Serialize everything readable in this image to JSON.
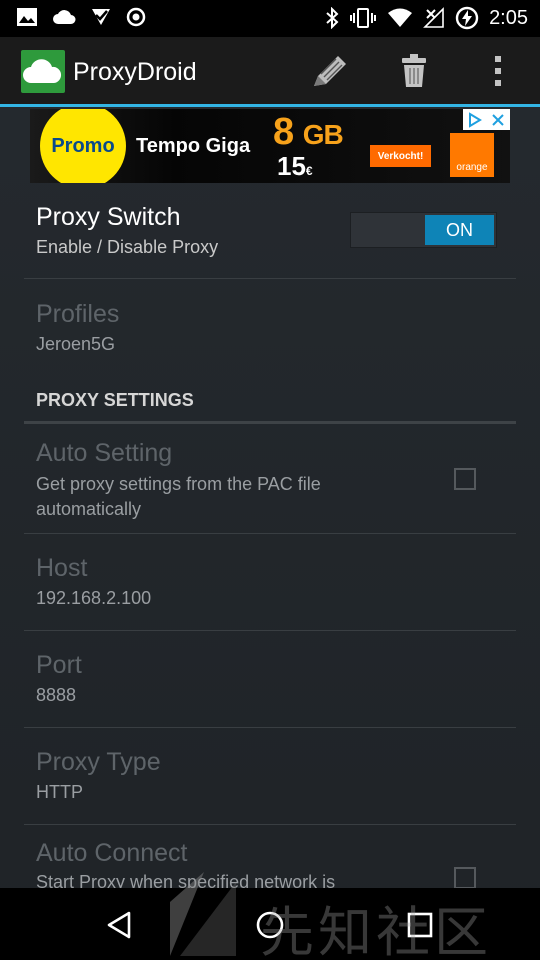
{
  "status_bar": {
    "time": "2:05",
    "icons": [
      "image-icon",
      "cloud-icon",
      "check-icon",
      "target-icon",
      "bluetooth-icon",
      "vibrate-icon",
      "wifi-icon",
      "no-signal-icon",
      "battery-charging-icon"
    ]
  },
  "action_bar": {
    "title": "ProxyDroid",
    "actions": [
      "edit-icon",
      "trash-icon",
      "overflow-menu-icon"
    ],
    "accent_color": "#33b5e5"
  },
  "ad": {
    "promo": "Promo",
    "headline": "Tempo Giga",
    "amount": "8",
    "unit": "GB",
    "price": "15",
    "currency": "€",
    "badge": "Verkocht!",
    "brand": "orange"
  },
  "proxy_switch": {
    "title": "Proxy Switch",
    "summary": "Enable / Disable Proxy",
    "state_label": "ON",
    "on": true
  },
  "profiles": {
    "title": "Profiles",
    "summary": "Jeroen5G"
  },
  "category": {
    "label": "PROXY SETTINGS"
  },
  "auto_setting": {
    "title": "Auto Setting",
    "summary": "Get proxy settings from the PAC file automatically",
    "checked": false
  },
  "host": {
    "title": "Host",
    "summary": "192.168.2.100"
  },
  "port": {
    "title": "Port",
    "summary": "8888"
  },
  "proxy_type": {
    "title": "Proxy Type",
    "summary": "HTTP"
  },
  "auto_connect": {
    "title": "Auto Connect",
    "summary": "Start Proxy when specified network is",
    "checked": false
  },
  "nav_bar": {
    "buttons": [
      "back-icon",
      "home-icon",
      "recents-icon"
    ]
  },
  "watermark": {
    "text": "先知社区"
  }
}
